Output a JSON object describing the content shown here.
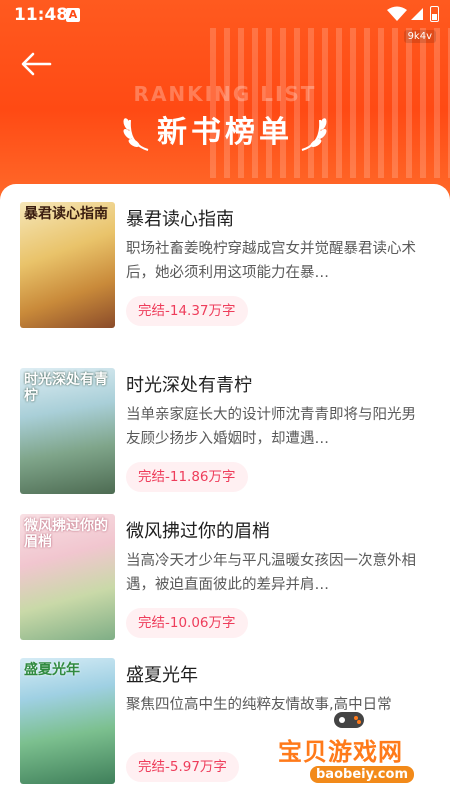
{
  "status_bar": {
    "time": "11:48",
    "notification_badge": "A",
    "carrier_tag": "9k4v"
  },
  "header": {
    "title": "新书榜单",
    "subtitle_en": "RANKING LIST",
    "back_icon": "arrow-left-icon"
  },
  "books": [
    {
      "title": "暴君读心指南",
      "description": "职场社畜姜晚柠穿越成宫女并觉醒暴君读心术后，她必须利用这项能力在暴…",
      "tag": "完结-14.37万字",
      "cover_text": "暴君读心指南"
    },
    {
      "title": "时光深处有青柠",
      "description": "当单亲家庭长大的设计师沈青青即将与阳光男友顾少扬步入婚姻时，却遭遇…",
      "tag": "完结-11.86万字",
      "cover_text": "时光深处有青柠"
    },
    {
      "title": "微风拂过你的眉梢",
      "description": "当高冷天才少年与平凡温暖女孩因一次意外相遇，被迫直面彼此的差异并肩…",
      "tag": "完结-10.06万字",
      "cover_text": "微风拂过你的眉梢"
    },
    {
      "title": "盛夏光年",
      "description": "聚焦四位高中生的纯粹友情故事,高中日常",
      "tag": "完结-5.97万字",
      "cover_text": "盛夏光年"
    }
  ],
  "watermark": {
    "cn": "宝贝游戏网",
    "en": "baobeiy.com"
  },
  "colors": {
    "header": "#ff4a14",
    "tag_bg": "#fff0f2",
    "tag_text": "#ee3d5b"
  }
}
